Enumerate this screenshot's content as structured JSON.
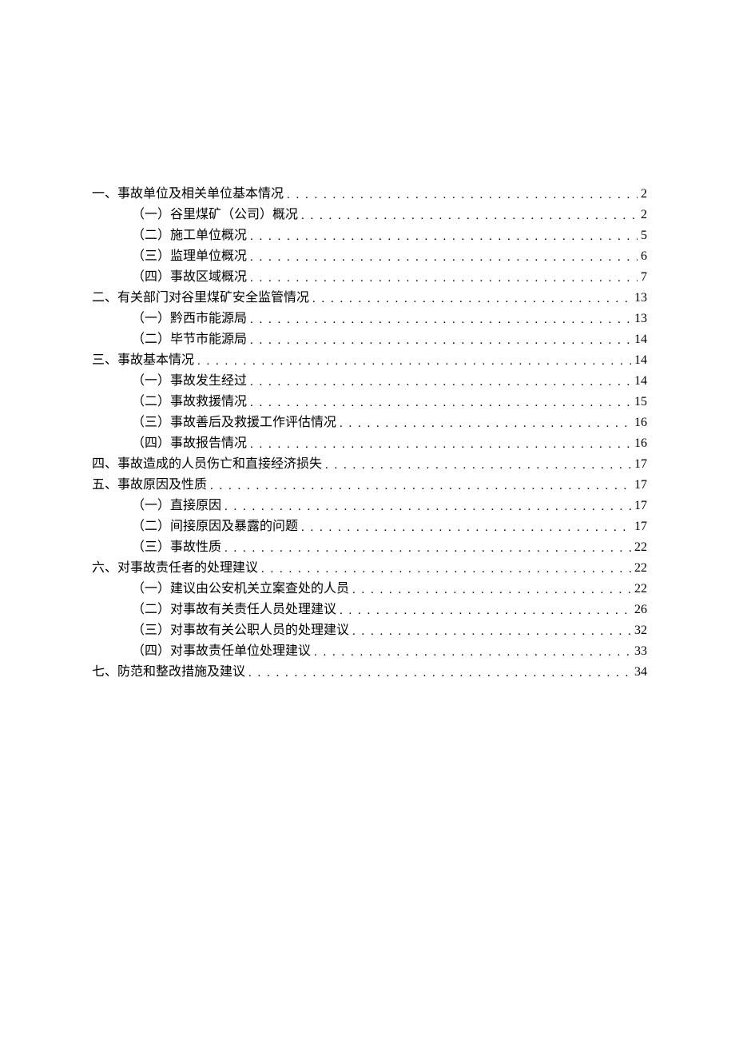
{
  "toc": [
    {
      "level": 1,
      "marker": "一、",
      "title": "事故单位及相关单位基本情况",
      "page": "2"
    },
    {
      "level": 2,
      "marker": "（一）",
      "title": "谷里煤矿（公司）概况",
      "page": "2"
    },
    {
      "level": 2,
      "marker": "（二）",
      "title": "施工单位概况",
      "page": "5"
    },
    {
      "level": 2,
      "marker": "（三）",
      "title": "监理单位概况",
      "page": "6"
    },
    {
      "level": 2,
      "marker": "（四）",
      "title": "事故区域概况",
      "page": "7"
    },
    {
      "level": 1,
      "marker": "二、",
      "title": "有关部门对谷里煤矿安全监管情况",
      "page": "13"
    },
    {
      "level": 2,
      "marker": "（一）",
      "title": "黔西市能源局",
      "page": "13"
    },
    {
      "level": 2,
      "marker": "（二）",
      "title": "毕节市能源局",
      "page": "14"
    },
    {
      "level": 1,
      "marker": "三、",
      "title": "事故基本情况",
      "page": "14"
    },
    {
      "level": 2,
      "marker": "（一）",
      "title": "事故发生经过",
      "page": "14"
    },
    {
      "level": 2,
      "marker": "（二）",
      "title": "事故救援情况",
      "page": "15"
    },
    {
      "level": 2,
      "marker": "（三）",
      "title": "事故善后及救援工作评估情况",
      "page": "16"
    },
    {
      "level": 2,
      "marker": "（四）",
      "title": "事故报告情况",
      "page": "16"
    },
    {
      "level": 1,
      "marker": "四、",
      "title": "事故造成的人员伤亡和直接经济损失",
      "page": "17"
    },
    {
      "level": 1,
      "marker": "五、",
      "title": "事故原因及性质",
      "page": "17"
    },
    {
      "level": 2,
      "marker": "（一）",
      "title": "直接原因",
      "page": "17"
    },
    {
      "level": 2,
      "marker": "（二）",
      "title": "间接原因及暴露的问题",
      "page": "17"
    },
    {
      "level": 2,
      "marker": "（三）",
      "title": "事故性质",
      "page": "22"
    },
    {
      "level": 1,
      "marker": "六、",
      "title": "对事故责任者的处理建议",
      "page": "22"
    },
    {
      "level": 2,
      "marker": "（一）",
      "title": "建议由公安机关立案查处的人员",
      "page": "22"
    },
    {
      "level": 2,
      "marker": "（二）",
      "title": "对事故有关责任人员处理建议",
      "page": "26"
    },
    {
      "level": 2,
      "marker": "（三）",
      "title": "对事故有关公职人员的处理建议",
      "page": "32"
    },
    {
      "level": 2,
      "marker": "（四）",
      "title": "对事故责任单位处理建议",
      "page": "33"
    },
    {
      "level": 1,
      "marker": "七、",
      "title": "防范和整改措施及建议",
      "page": "34"
    }
  ]
}
